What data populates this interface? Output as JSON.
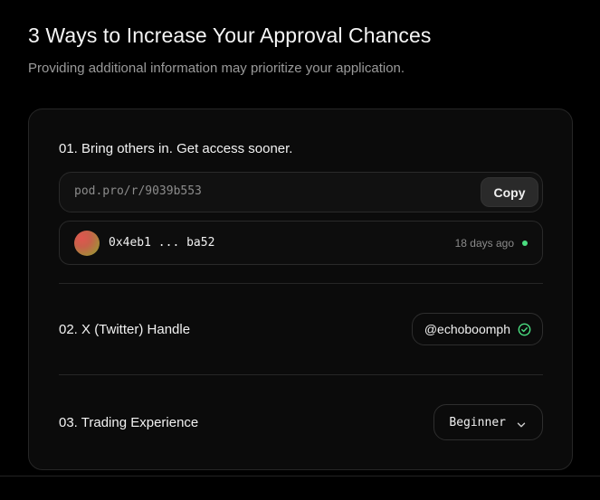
{
  "header": {
    "title": "3 Ways to Increase Your Approval Chances",
    "subtitle": "Providing additional information may prioritize your application."
  },
  "colors": {
    "background": "#000000",
    "card": "#0b0b0b",
    "accent_green": "#4ade80",
    "muted_text": "#9a9a9a"
  },
  "steps": {
    "referral": {
      "title": "01. Bring others in. Get access sooner.",
      "link": "pod.pro/r/9039b553",
      "copy_label": "Copy",
      "entries": [
        {
          "wallet": "0x4eb1 ... ba52",
          "joined": "18 days ago",
          "status_color": "#4ade80",
          "avatar_icon": "gradient-avatar"
        }
      ]
    },
    "twitter": {
      "title": "02. X (Twitter) Handle",
      "handle": "@echoboomph",
      "verified_icon": "check-circle-icon"
    },
    "trading": {
      "title": "03. Trading Experience",
      "selected": "Beginner",
      "dropdown_icon": "chevron-down-icon"
    }
  }
}
